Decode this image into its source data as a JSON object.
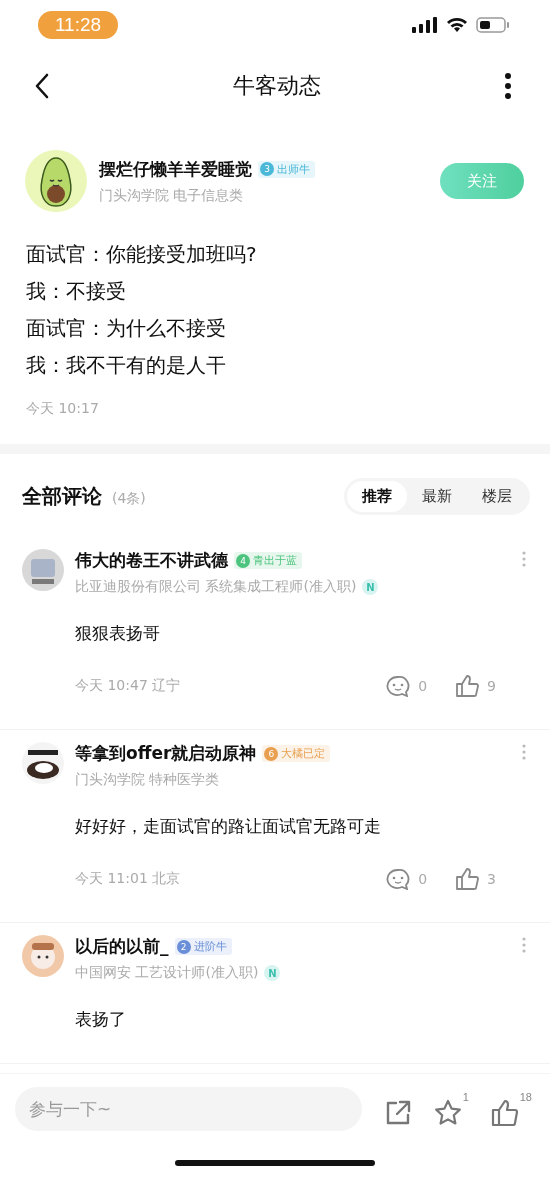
{
  "status_bar": {
    "time": "11:28"
  },
  "nav": {
    "title": "牛客动态"
  },
  "post": {
    "author": {
      "name": "摆烂仔懒羊羊爱睡觉",
      "badge": {
        "level": "3",
        "label": "出师牛",
        "color": "#4bb8d8"
      },
      "school": "门头沟学院 电子信息类"
    },
    "follow_button": "关注",
    "lines": [
      "面试官：你能接受加班吗?",
      "我：不接受",
      "面试官：为什么不接受",
      "我：我不干有的是人干"
    ],
    "time": "今天 10:17"
  },
  "comments_header": {
    "title": "全部评论",
    "count": "(4条)",
    "sort_tabs": [
      {
        "label": "推荐",
        "selected": true
      },
      {
        "label": "最新",
        "selected": false
      },
      {
        "label": "楼层",
        "selected": false
      }
    ]
  },
  "comments": [
    {
      "name": "伟大的卷王不讲武德",
      "badge": {
        "level": "4",
        "label": "青出于蓝",
        "color": "#4cc47e"
      },
      "info": "比亚迪股份有限公司 系统集成工程师(准入职)",
      "mark": "N",
      "text": "狠狠表扬哥",
      "meta": "今天 10:47 辽宁",
      "replies": "0",
      "likes": "9"
    },
    {
      "name": "等拿到offer就启动原神",
      "badge": {
        "level": "6",
        "label": "大橘已定",
        "color": "#e8a050"
      },
      "info": "门头沟学院 特种医学类",
      "text": "好好好，走面试官的路让面试官无路可走",
      "meta": "今天 11:01 北京",
      "replies": "0",
      "likes": "3"
    },
    {
      "name": "以后的以前_",
      "badge": {
        "level": "2",
        "label": "进阶牛",
        "color": "#6a8fd8"
      },
      "info": "中国网安 工艺设计师(准入职)",
      "mark": "N",
      "text": "表扬了"
    }
  ],
  "bottom_bar": {
    "placeholder": "参与一下~",
    "star_count": "1",
    "like_count": "18"
  }
}
